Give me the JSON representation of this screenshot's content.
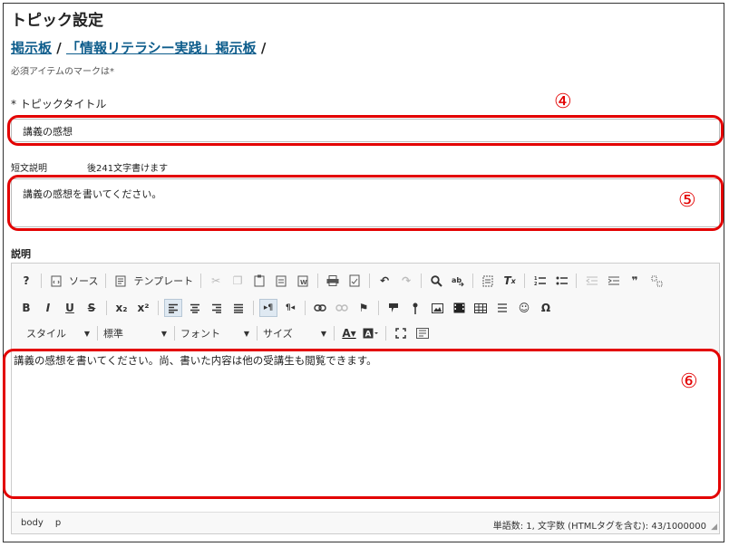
{
  "page": {
    "title": "トピック設定",
    "breadcrumb": [
      "掲示板",
      "「情報リテラシー実践」掲示板"
    ],
    "breadcrumb_sep": "/",
    "required_note": "必須アイテムのマークは*"
  },
  "topic_title": {
    "label": "* トピックタイトル",
    "value": "講義の感想"
  },
  "short_desc": {
    "label": "短文説明",
    "remaining": "後241文字書けます",
    "value": "講義の感想を書いてください。"
  },
  "description": {
    "label": "説明",
    "toolbar_row1": {
      "help": "?",
      "source": "ソース",
      "template": "テンプレート"
    },
    "toolbar_row2": {
      "bold": "B",
      "italic": "I",
      "underline": "U",
      "strike": "S",
      "subscript": "x₂",
      "superscript": "x²"
    },
    "toolbar_row3": {
      "style": "スタイル",
      "format": "標準",
      "font": "フォント",
      "size": "サイズ"
    },
    "content": "講義の感想を書いてください。尚、書いた内容は他の受講生も閲覧できます。",
    "status_path": [
      "body",
      "p"
    ],
    "status_count": "単語数: 1, 文字数 (HTMLタグを含む): 43/1000000"
  },
  "annotations": {
    "marker_4": "④",
    "marker_5": "⑤",
    "marker_6": "⑥",
    "color": "#e30000"
  }
}
